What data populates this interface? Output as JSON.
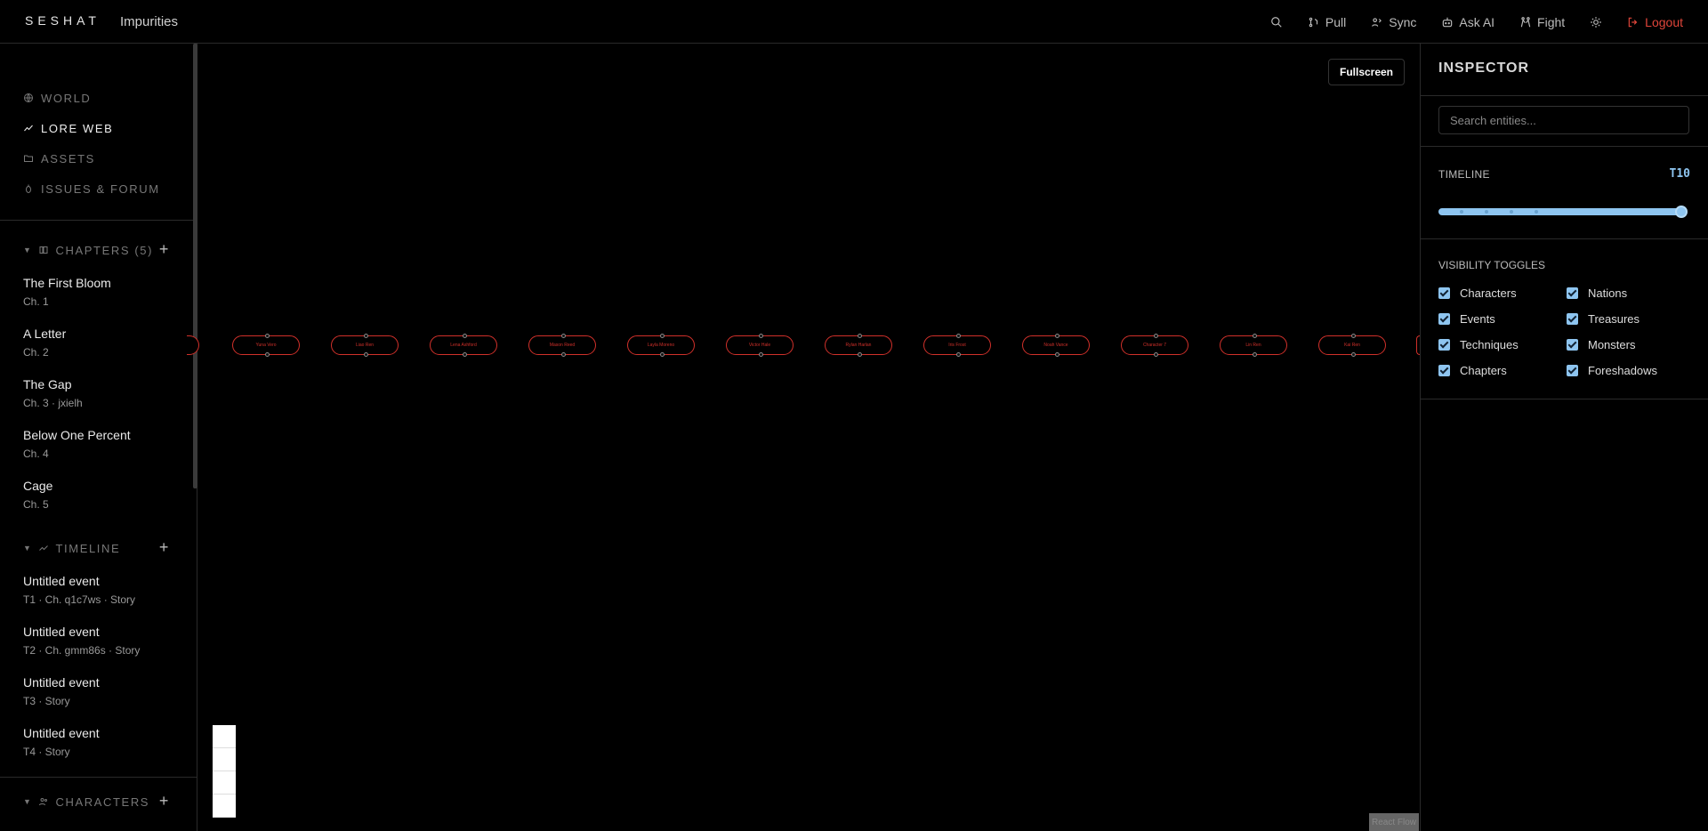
{
  "header": {
    "brand": "SESHAT",
    "project": "Impurities",
    "nav": [
      {
        "label": "",
        "icon": "search-icon"
      },
      {
        "label": "Pull",
        "icon": "pull-icon"
      },
      {
        "label": "Sync",
        "icon": "sync-icon"
      },
      {
        "label": "Ask AI",
        "icon": "robot-icon"
      },
      {
        "label": "Fight",
        "icon": "fight-icon"
      },
      {
        "label": "",
        "icon": "sun-icon"
      },
      {
        "label": "Logout",
        "icon": "logout-icon"
      }
    ]
  },
  "sidebar": {
    "nav": [
      {
        "label": "WORLD",
        "icon": "globe-icon"
      },
      {
        "label": "LORE WEB",
        "icon": "graph-icon"
      },
      {
        "label": "ASSETS",
        "icon": "folder-icon"
      },
      {
        "label": "ISSUES & FORUM",
        "icon": "bug-icon"
      }
    ],
    "chapters": {
      "heading": "CHAPTERS (5)",
      "items": [
        {
          "title": "The First Bloom",
          "sub": "Ch. 1"
        },
        {
          "title": "A Letter",
          "sub": "Ch. 2"
        },
        {
          "title": "The Gap",
          "sub": "Ch. 3 · jxielh"
        },
        {
          "title": "Below One Percent",
          "sub": "Ch. 4"
        },
        {
          "title": "Cage",
          "sub": "Ch. 5"
        }
      ]
    },
    "timeline": {
      "heading": "TIMELINE",
      "items": [
        {
          "title": "Untitled event",
          "sub": "T1 · Ch. q1c7ws · Story"
        },
        {
          "title": "Untitled event",
          "sub": "T2 · Ch. gmm86s · Story"
        },
        {
          "title": "Untitled event",
          "sub": "T3 · Story"
        },
        {
          "title": "Untitled event",
          "sub": "T4 · Story"
        }
      ]
    },
    "characters": {
      "heading": "CHARACTERS"
    }
  },
  "canvas": {
    "fullscreen_label": "Fullscreen",
    "nodes": [
      "Yuna Vero",
      "Liao Ren",
      "Lena Ashford",
      "Mason Reed",
      "Layla Moreno",
      "Victor Hale",
      "Rylan Harlan",
      "Iris Frost",
      "Noah Vance",
      "Character 7",
      "Lin Ren",
      "Kai Ren"
    ],
    "attribution": "React Flow"
  },
  "inspector": {
    "title": "INSPECTOR",
    "search_placeholder": "Search entities...",
    "timeline_label": "TIMELINE",
    "timeline_value": "T10",
    "visibility_label": "VISIBILITY TOGGLES",
    "toggles": [
      {
        "label": "Characters",
        "checked": true
      },
      {
        "label": "Nations",
        "checked": true
      },
      {
        "label": "Events",
        "checked": true
      },
      {
        "label": "Treasures",
        "checked": true
      },
      {
        "label": "Techniques",
        "checked": true
      },
      {
        "label": "Monsters",
        "checked": true
      },
      {
        "label": "Chapters",
        "checked": true
      },
      {
        "label": "Foreshadows",
        "checked": true
      }
    ]
  },
  "colors": {
    "accent": "#8ec5f0",
    "node": "#d0302a",
    "logout": "#e0453a"
  }
}
